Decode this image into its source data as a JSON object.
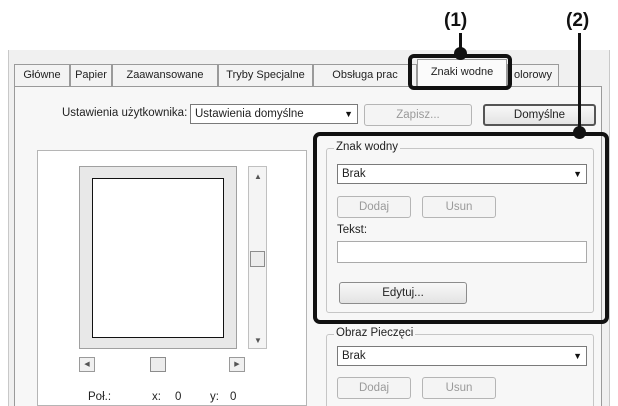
{
  "callouts": {
    "one": "(1)",
    "two": "(2)"
  },
  "tabs": [
    {
      "label": "Główne"
    },
    {
      "label": "Papier"
    },
    {
      "label": "Zaawansowane"
    },
    {
      "label": "Tryby Specjalne"
    },
    {
      "label": "Obsługa prac"
    },
    {
      "label": "Znaki wodne"
    },
    {
      "label": "olorowy"
    }
  ],
  "user_settings": {
    "label": "Ustawienia użytkownika:",
    "value": "Ustawienia domyślne",
    "save_label": "Zapisz...",
    "defaults_label": "Domyślne"
  },
  "watermark": {
    "group_label": "Znak wodny",
    "select_value": "Brak",
    "add_label": "Dodaj",
    "delete_label": "Usun",
    "text_label": "Tekst:",
    "text_value": "",
    "edit_label": "Edytuj..."
  },
  "stamp": {
    "group_label": "Obraz Pieczęci",
    "select_value": "Brak",
    "add_label": "Dodaj",
    "delete_label": "Usun"
  },
  "position": {
    "label": "Poł.:",
    "x_label": "x:",
    "x_value": "0",
    "y_label": "y:",
    "y_value": "0"
  },
  "icons": {
    "dropdown": "chevron-down-icon",
    "scroll_up": "arrow-up-icon",
    "scroll_down": "arrow-down-icon",
    "scroll_left": "arrow-left-icon",
    "scroll_right": "arrow-right-icon"
  },
  "colors": {
    "highlight": "#111111",
    "window_bg": "#f0f0f0",
    "tab_page_bg": "#f7f7f7"
  }
}
